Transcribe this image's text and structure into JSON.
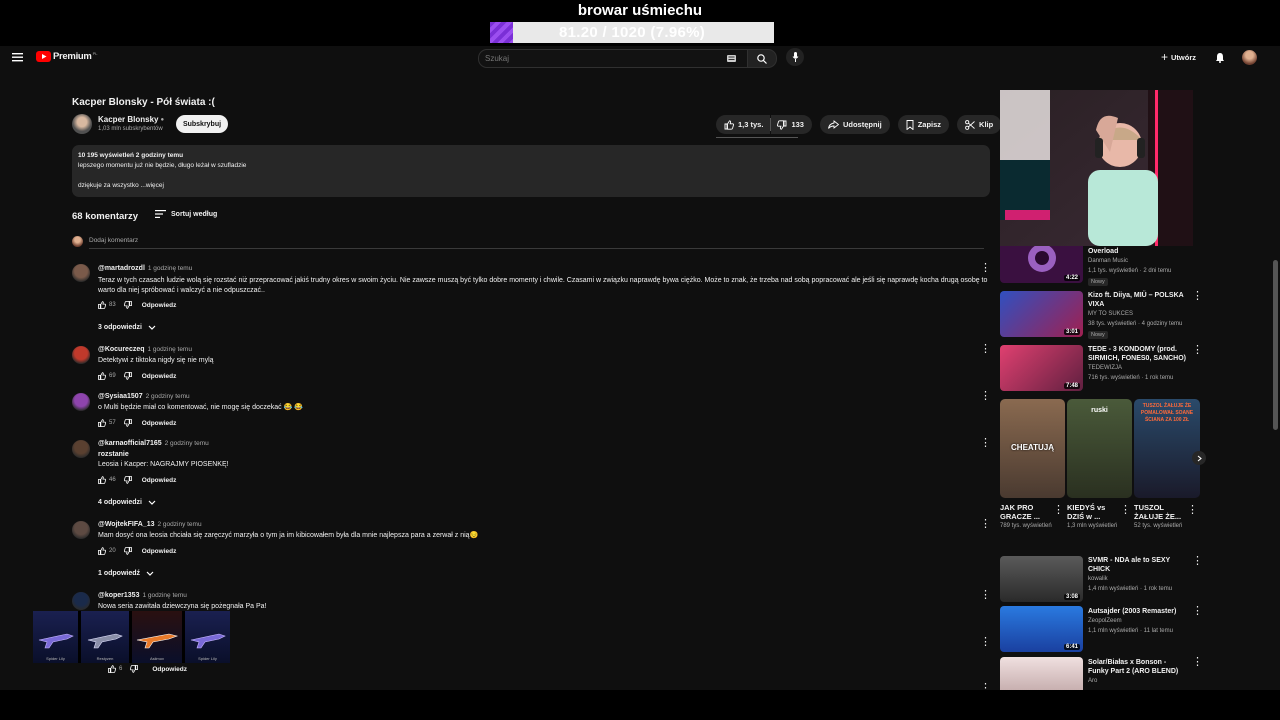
{
  "overlay": {
    "stream_title": "browar uśmiechu",
    "goal_text": "81.20 / 1020 (7.96%)",
    "goal_fraction": 0.0796
  },
  "header": {
    "brand": "Premium",
    "brand_region": "PL",
    "search_placeholder": "Szukaj",
    "create_label": "Utwórz"
  },
  "video": {
    "title": "Kacper Blonsky - Pół świata :(",
    "channel_name": "Kacper Blonsky",
    "subscribers": "1,03 mln subskrybentów",
    "subscribe_label": "Subskrybuj",
    "likes": "1,3 tys.",
    "dislikes": "133",
    "share_label": "Udostępnij",
    "save_label": "Zapisz",
    "clip_label": "Klip",
    "description": {
      "stats": "10 195 wyświetleń  2 godziny temu",
      "line1": "lepszego momentu już nie będzie, długo leżał w szufladzie",
      "line2": "dziękuje za wszystko ...więcej"
    }
  },
  "comments_section": {
    "count_label": "68 komentarzy",
    "sort_label": "Sortuj według",
    "add_placeholder": "Dodaj komentarz",
    "reply_label": "Odpowiedz",
    "items": [
      {
        "author": "@martadrozdl",
        "time": "1 godzinę temu",
        "text": "Teraz w tych czasach ludzie wolą się rozstać niż przepracować jakiś trudny okres w swoim życiu. Nie zawsze muszą być tylko dobre momenty i chwile. Czasami w związku naprawdę bywa ciężko. Może to znak, że trzeba nad sobą popracować ale jeśli się naprawdę kocha drugą osobę to warto dla niej spróbować i walczyć a nie odpuszczać..",
        "likes": "83",
        "replies": "3 odpowiedzi",
        "avatar_color": "#7a5a4a"
      },
      {
        "author": "@Kocureczeq",
        "time": "1 godzinę temu",
        "text": "Detektywi z tiktoka nigdy się nie mylą",
        "likes": "69",
        "replies": "",
        "avatar_color": "#c0392b"
      },
      {
        "author": "@Sysiaa1507",
        "time": "2 godziny temu",
        "text": "o Multi będzie miał co komentować, nie mogę się doczekać 😂 😂",
        "likes": "57",
        "replies": "",
        "avatar_color": "#8e44ad"
      },
      {
        "author": "@karnaofficial7165",
        "time": "2 godziny temu",
        "text_line1": "rozstanie",
        "text": "Leosia i Kacper: NAGRAJMY PIOSENKĘ!",
        "likes": "46",
        "replies": "4 odpowiedzi",
        "avatar_color": "#5a4030"
      },
      {
        "author": "@WojtekFIFA_13",
        "time": "2 godziny temu",
        "text": "Mam dosyć ona leosia chciała się zaręczyć marzyła o tym ja im kibicowałem była dla mnie  najlepsza para a zerwał z nią😔",
        "likes": "20",
        "replies": "1 odpowiedź",
        "avatar_color": "#5d4a42"
      },
      {
        "author": "@koper1353",
        "time": "1 godzinę temu",
        "text": "Nowa seria zawitała dziewczyna się pożegnała Pa Pa!",
        "likes": "6",
        "replies": "",
        "avatar_color": "#1a2a4a"
      }
    ]
  },
  "skins_overlay": {
    "items": [
      "Spider Lily",
      "Restyzen",
      "Asiimov",
      "Spider Lily"
    ]
  },
  "recommendations": {
    "items": [
      {
        "title": "Overload",
        "channel": "Danman Music",
        "meta": "1,1 tys. wyświetleń · 2 dni temu",
        "duration": "4:22",
        "badge": "Nowy",
        "thumb": "#3a1040"
      },
      {
        "title": "Kizo ft. Diiya, MIÜ – POLSKA VIXA",
        "channel": "MY TO SUKCES",
        "meta": "38 tys. wyświetleń · 4 godziny temu",
        "duration": "3:01",
        "badge": "Nowy",
        "thumb": "#2a3a8a"
      },
      {
        "title": "TEDE - 3 KONDOMY (prod. SIRMICH, FONES0, SANCHO)",
        "channel": "TEDEWIZJA",
        "meta": "716 tys. wyświetleń · 1 rok temu",
        "duration": "7:48",
        "thumb": "#8a1a3a"
      },
      {
        "title": "SVMR - NDA ale to SEXY CHICK",
        "channel": "kowalik",
        "meta": "1,4 mln wyświetleń · 1 rok temu",
        "duration": "3:08",
        "thumb": "#3a3a3a"
      },
      {
        "title": "Autsajder (2003 Remaster)",
        "channel": "ZeopolZeem",
        "meta": "1,1 mln wyświetleń · 11 lat temu",
        "duration": "6:41",
        "thumb": "#1a5ac0"
      },
      {
        "title": "Solar/Białas x Bonson - Funky Part 2 (ARO BLEND)",
        "channel": "Aro",
        "meta": "",
        "duration": "",
        "thumb": "#d8c8c8"
      }
    ],
    "shorts": [
      {
        "title": "JAK PRO GRACZE ...",
        "views": "789 tys. wyświetleń",
        "overlay": "CHEATUJĄ",
        "thumb": "#6a5040"
      },
      {
        "title": "KIEDYŚ vs DZIŚ w ...",
        "views": "1,3 mln wyświetleń",
        "overlay": "ruski",
        "thumb": "#3a4a2a"
      },
      {
        "title": "TUSZOL ŻAŁUJE ŻE...",
        "views": "52 tys. wyświetleń",
        "overlay": "TUSZOL ŻAŁUJE ŻE POMALOWAŁ SOANE ŚCIANA ZA 100 ZŁ",
        "thumb": "#1a2a3a"
      }
    ]
  },
  "colors": {
    "bg": "#0f0f0f",
    "accent": "#ff0000",
    "goal_fill": "#8a3ee6"
  }
}
